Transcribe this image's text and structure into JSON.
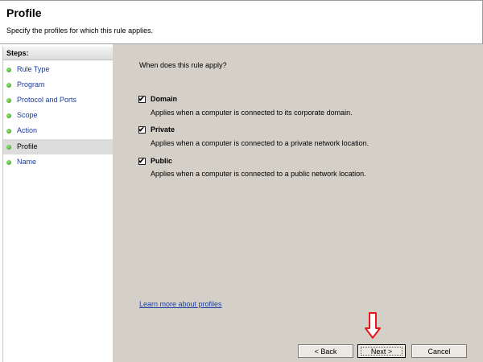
{
  "header": {
    "title": "Profile",
    "subtitle": "Specify the profiles for which this rule applies."
  },
  "steps": {
    "heading": "Steps:",
    "items": [
      {
        "label": "Rule Type",
        "active": false
      },
      {
        "label": "Program",
        "active": false
      },
      {
        "label": "Protocol and Ports",
        "active": false
      },
      {
        "label": "Scope",
        "active": false
      },
      {
        "label": "Action",
        "active": false
      },
      {
        "label": "Profile",
        "active": true
      },
      {
        "label": "Name",
        "active": false
      }
    ]
  },
  "main": {
    "question": "When does this rule apply?",
    "options": [
      {
        "label": "Domain",
        "checked": true,
        "description": "Applies when a computer is connected to its corporate domain."
      },
      {
        "label": "Private",
        "checked": true,
        "description": "Applies when a computer is connected to a private network location."
      },
      {
        "label": "Public",
        "checked": true,
        "description": "Applies when a computer is connected to a public network location."
      }
    ],
    "learn_more": "Learn more about profiles"
  },
  "buttons": {
    "back": "< Back",
    "next": "Next >",
    "cancel": "Cancel"
  },
  "colors": {
    "content_bg": "#d4d0c8",
    "link": "#1b3ea6",
    "step_link": "#1a3a9a",
    "step_dot": "#2b9a19",
    "annotation_arrow": "#e8161b"
  },
  "icons": {
    "step_bullet": "green-dot-icon",
    "checkbox_mark": "checkmark-icon",
    "annotation": "down-arrow-icon"
  }
}
